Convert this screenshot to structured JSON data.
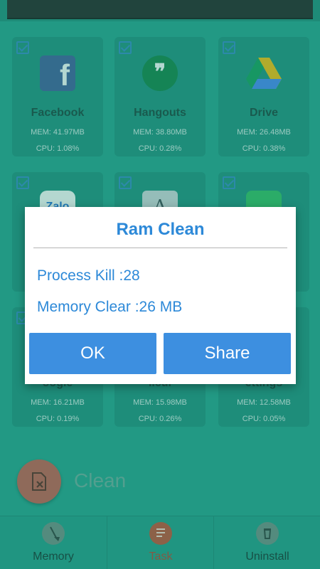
{
  "apps": [
    {
      "name": "Facebook",
      "mem": "MEM: 41.97MB",
      "cpu": "CPU: 1.08%",
      "icon": "facebook-icon",
      "glyph": "f"
    },
    {
      "name": "Hangouts",
      "mem": "MEM: 38.80MB",
      "cpu": "CPU: 0.28%",
      "icon": "hangouts-icon",
      "glyph": "❞"
    },
    {
      "name": "Drive",
      "mem": "MEM: 26.48MB",
      "cpu": "CPU: 0.38%",
      "icon": "drive-icon"
    },
    {
      "name": "",
      "mem": "",
      "cpu": "",
      "icon": "zalo-icon",
      "glyph": "Zalo"
    },
    {
      "name": "",
      "mem": "",
      "cpu": "",
      "icon": "translate-icon",
      "glyph": "A"
    },
    {
      "name": "",
      "mem": "",
      "cpu": "",
      "icon": "evernote-icon"
    },
    {
      "name": "oogle",
      "mem": "MEM: 16.21MB",
      "cpu": "CPU: 0.19%",
      "icon": ""
    },
    {
      "name": "ilcul",
      "mem": "MEM: 15.98MB",
      "cpu": "CPU: 0.26%",
      "icon": ""
    },
    {
      "name": "ettings",
      "mem": "MEM: 12.58MB",
      "cpu": "CPU: 0.05%",
      "icon": ""
    }
  ],
  "clean": {
    "label": "Clean",
    "icon": "clean-file-x-icon"
  },
  "nav": {
    "memory": {
      "label": "Memory",
      "icon": "broom-icon"
    },
    "task": {
      "label": "Task",
      "icon": "task-list-icon"
    },
    "uninstall": {
      "label": "Uninstall",
      "icon": "trash-icon"
    }
  },
  "dialog": {
    "title": "Ram Clean",
    "process_kill": "Process Kill :28",
    "memory_clear": "Memory Clear :26 MB",
    "ok_label": "OK",
    "share_label": "Share"
  },
  "colors": {
    "background": "#1fa08a",
    "dialog_accent": "#2d89d8",
    "button": "#3d8fe0",
    "clean_button": "#c7584a",
    "active_tab": "#b3402a"
  }
}
